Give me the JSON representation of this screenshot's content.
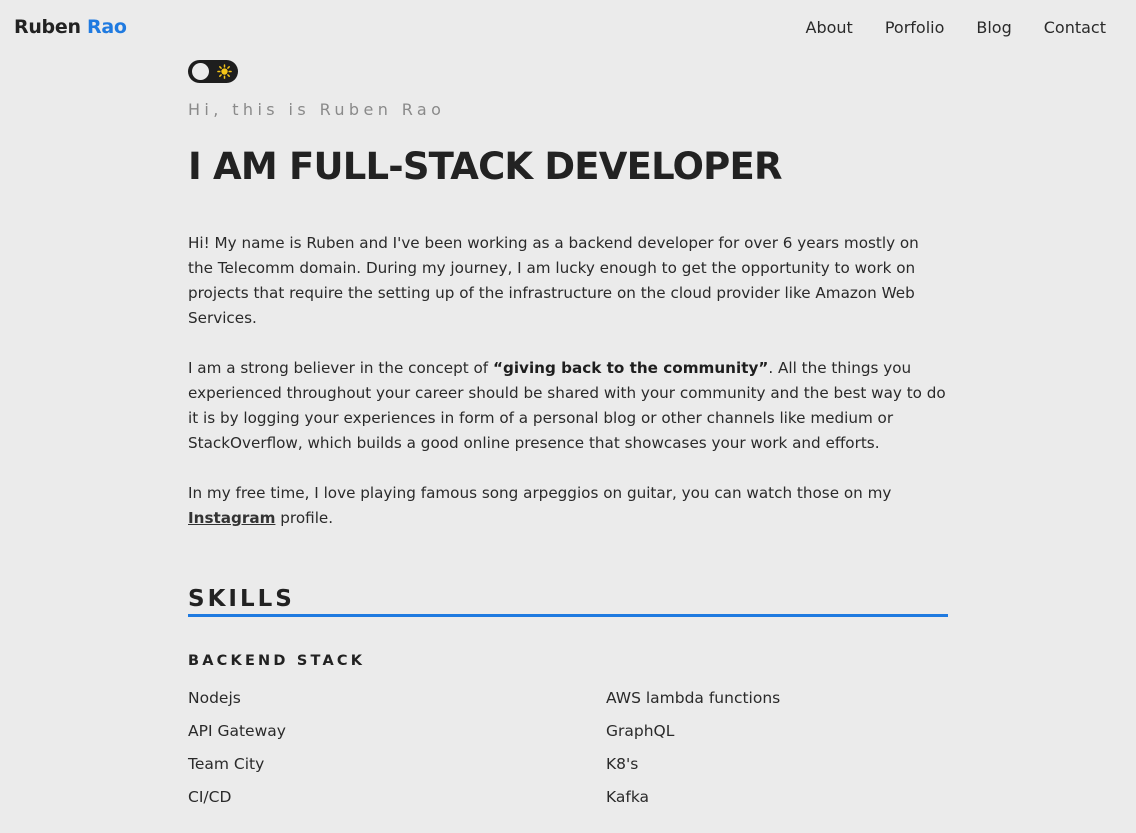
{
  "brand": {
    "first": "Ruben",
    "last": "Rao",
    "accent_color": "#1f7ae0"
  },
  "nav": {
    "items": [
      {
        "label": "About"
      },
      {
        "label": "Porfolio"
      },
      {
        "label": "Blog"
      },
      {
        "label": "Contact"
      }
    ]
  },
  "theme_toggle": {
    "state": "light",
    "icon": "sun-icon"
  },
  "hero": {
    "greeting": "Hi, this is Ruben Rao",
    "headline": "I AM FULL-STACK DEVELOPER"
  },
  "about": {
    "p1": "Hi! My name is Ruben and I've been working as a backend developer for over 6 years mostly on the Telecomm domain. During my journey, I am lucky enough to get the opportunity to work on projects that require the setting up of the infrastructure on the cloud provider like Amazon Web Services.",
    "p2_before": "I am a strong believer in the concept of ",
    "p2_bold": "“giving back to the community”",
    "p2_after": ". All the things you experienced throughout your career should be shared with your community and the best way to do it is by logging your experiences in form of a personal blog or other channels like medium or StackOverflow, which builds a good online presence that showcases your work and efforts.",
    "p3_before": "In my free time, I love playing famous song arpeggios on guitar, you can watch those on my ",
    "p3_link": "Instagram",
    "p3_after": " profile."
  },
  "skills": {
    "title": "SKILLS",
    "backend": {
      "title": "BACKEND STACK",
      "items": [
        "Nodejs",
        "AWS lambda functions",
        "API Gateway",
        "GraphQL",
        "Team City",
        "K8's",
        "CI/CD",
        "Kafka"
      ]
    }
  }
}
